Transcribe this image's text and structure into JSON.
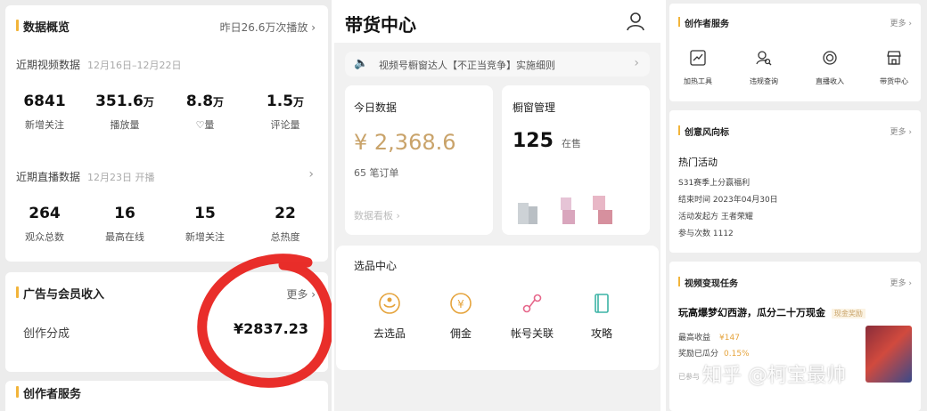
{
  "panelA": {
    "overview": {
      "title": "数据概览",
      "more": "昨日26.6万次播放",
      "recentVideo": {
        "label": "近期视频数据",
        "range": "12月16日–12月22日"
      },
      "videoStats": [
        {
          "value": "6841",
          "unit": "",
          "label": "新增关注"
        },
        {
          "value": "351.6",
          "unit": "万",
          "label": "播放量"
        },
        {
          "value": "8.8",
          "unit": "万",
          "label": "♡量"
        },
        {
          "value": "1.5",
          "unit": "万",
          "label": "评论量"
        }
      ],
      "recentLive": {
        "label": "近期直播数据",
        "date": "12月23日 开播"
      },
      "liveStats": [
        {
          "value": "264",
          "label": "观众总数"
        },
        {
          "value": "16",
          "label": "最高在线"
        },
        {
          "value": "15",
          "label": "新增关注"
        },
        {
          "value": "22",
          "label": "总热度"
        }
      ]
    },
    "income": {
      "title": "广告与会员收入",
      "more": "更多",
      "rowLabel": "创作分成",
      "rowValue": "¥2837.23"
    },
    "nextSection": "创作者服务"
  },
  "panelB": {
    "title": "带货中心",
    "notice": "视频号橱窗达人【不正当竞争】实施细则",
    "today": {
      "title": "今日数据",
      "amount": "¥ 2,368.6",
      "orders": "65 笔订单",
      "link": "数据看板"
    },
    "showcase": {
      "title": "橱窗管理",
      "count": "125",
      "unit": "在售"
    },
    "selection": {
      "title": "选品中心",
      "items": [
        {
          "label": "去选品",
          "icon": "select-product-icon"
        },
        {
          "label": "佣金",
          "icon": "commission-icon"
        },
        {
          "label": "帐号关联",
          "icon": "account-link-icon"
        },
        {
          "label": "攻略",
          "icon": "guide-book-icon"
        }
      ]
    }
  },
  "panelC": {
    "services": {
      "title": "创作者服务",
      "more": "更多",
      "items": [
        {
          "label": "加热工具",
          "icon": "trend-chart-icon"
        },
        {
          "label": "违规查询",
          "icon": "search-user-icon"
        },
        {
          "label": "直播收入",
          "icon": "live-income-icon"
        },
        {
          "label": "带货中心",
          "icon": "shop-icon"
        }
      ]
    },
    "trends": {
      "title": "创意风向标",
      "more": "更多",
      "heading": "热门活动",
      "lines": [
        "S31赛季上分赢福利",
        "结束时间  2023年04月30日",
        "活动发起方  王者荣耀",
        "参与次数  1112"
      ]
    },
    "tasks": {
      "title": "视频变现任务",
      "more": "更多",
      "heading": "玩高爆梦幻西游，瓜分二十万现金",
      "badge": "现金奖励",
      "maxLabel": "最高收益",
      "maxValue": "¥147",
      "ratioLabel": "奖励已瓜分",
      "ratioValue": "0.15%",
      "footer": "已参与"
    }
  },
  "watermark": "知乎 @柯宝最帅",
  "colors": {
    "accent": "#f2b43a",
    "amount": "#c9a36a",
    "pink": "#e6668a",
    "orange": "#e5a33b",
    "circle": "#e8231f"
  }
}
